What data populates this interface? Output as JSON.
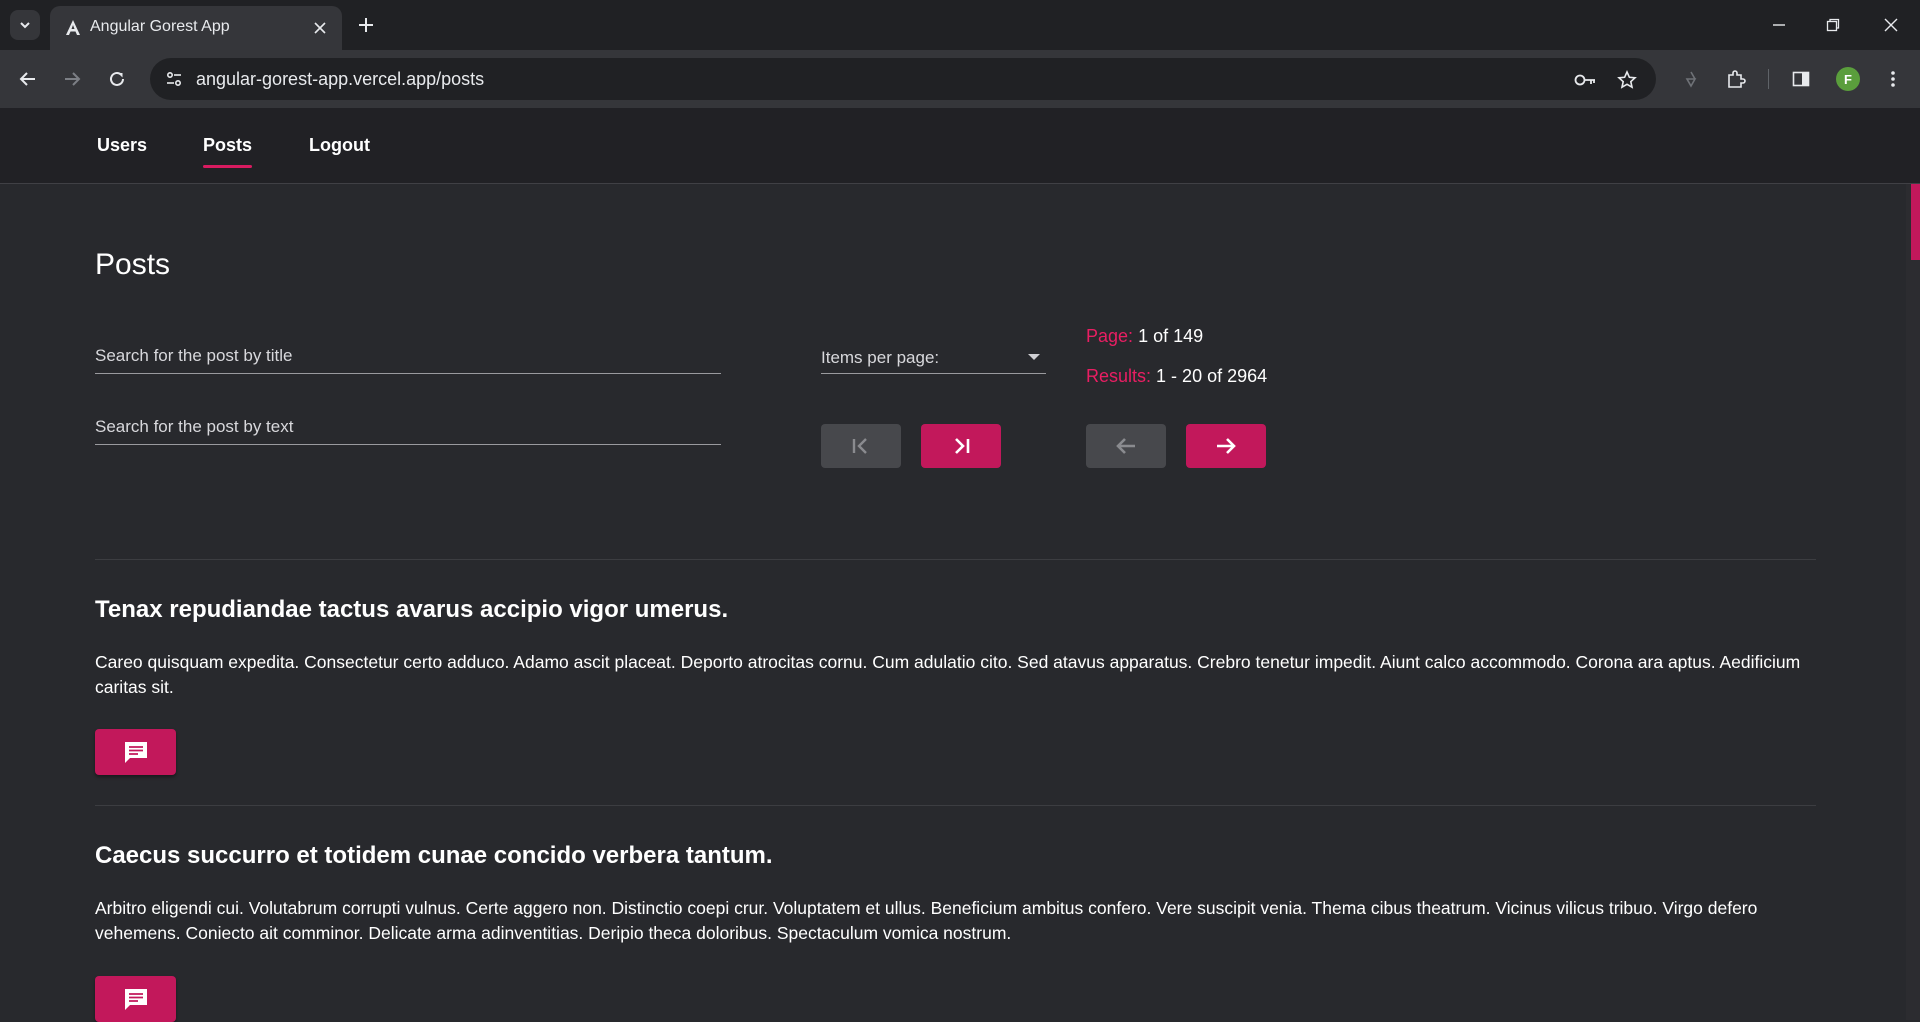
{
  "browser": {
    "tab_title": "Angular Gorest App",
    "url": "angular-gorest-app.vercel.app/posts",
    "profile_initial": "F"
  },
  "nav": {
    "users": "Users",
    "posts": "Posts",
    "logout": "Logout",
    "active": "posts"
  },
  "page": {
    "title": "Posts"
  },
  "search": {
    "title_placeholder": "Search for the post by title",
    "text_placeholder": "Search for the post by text"
  },
  "pagination": {
    "items_per_page_label": "Items per page:",
    "page_key": "Page:",
    "page_value": "1 of 149",
    "results_key": "Results:",
    "results_value": "1 - 20 of 2964"
  },
  "posts": [
    {
      "title": "Tenax repudiandae tactus avarus accipio vigor umerus.",
      "body": "Careo quisquam expedita. Consectetur certo adduco. Adamo ascit placeat. Deporto atrocitas cornu. Cum adulatio cito. Sed atavus apparatus. Crebro tenetur impedit. Aiunt calco accommodo. Corona ara aptus. Aedificium caritas sit."
    },
    {
      "title": "Caecus succurro et totidem cunae concido verbera tantum.",
      "body": "Arbitro eligendi cui. Volutabrum corrupti vulnus. Certe aggero non. Distinctio coepi crur. Voluptatem et ullus. Beneficium ambitus confero. Vere suscipit venia. Thema cibus theatrum. Vicinus vilicus tribuo. Virgo defero vehemens. Coniecto ait comminor. Delicate arma adinventitias. Deripio theca doloribus. Spectaculum vomica nostrum."
    }
  ],
  "colors": {
    "accent": "#c2185b",
    "accent_text": "#e91e63",
    "background": "#28292d",
    "nav_background": "#212125"
  }
}
